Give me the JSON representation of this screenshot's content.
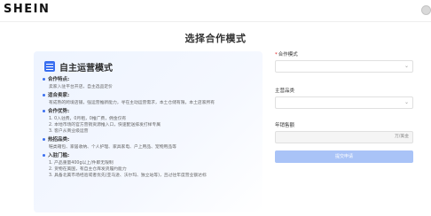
{
  "header": {
    "logo": "SHEIN"
  },
  "page": {
    "title": "选择合作模式"
  },
  "card": {
    "title": "自主运营模式",
    "sections": [
      {
        "label": "合作特点:",
        "lines": [
          "卖家入驻平台开店，自主选品定价"
        ]
      },
      {
        "label": "适合卖家:",
        "lines": [
          "有成熟的跨境店铺，强运营推新能力，寻在主动运营需求，本土仓储有限，本土店家所有"
        ]
      },
      {
        "label": "合作优势:",
        "lines": [
          "1. 0入驻费，0月租，0推广费，佣金仅有",
          "2. 本地市场的官方营销资源推入口，快速配送排发打样专属",
          "3. 客户从商业级运营"
        ]
      },
      {
        "label": "热招品类:",
        "lines": [
          "鞋类箱包、家居收纳、个人护理、家具家电、户上用品、宠物用品等"
        ]
      },
      {
        "label": "入驻门槛:",
        "lines": [
          "1. 产品重量400g以上/件即无限制",
          "2. 货物在美国，有自主仓库发货履约能力",
          "3. 具备北美市场经验或者优先(亚马逊、沃尔玛、独立站等)，且过往年度营业额达标"
        ]
      }
    ]
  },
  "form": {
    "mode_label": "合作模式",
    "category_label": "主营品类",
    "revenue_label": "年销售额",
    "revenue_unit": "万/美金",
    "required_mark": "*",
    "submit_label": "提交申请",
    "select_chevron": "⌄"
  },
  "colors": {
    "accent": "#3a6ff0",
    "submit_disabled": "#a9c3f7"
  }
}
